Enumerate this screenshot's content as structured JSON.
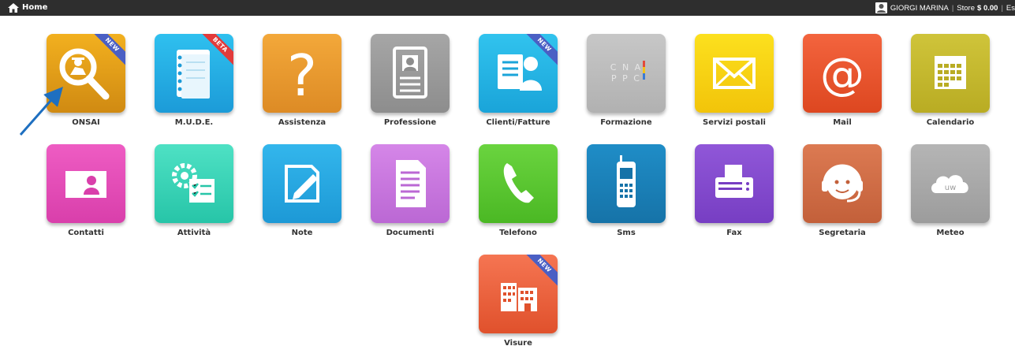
{
  "topbar": {
    "home_label": "Home",
    "user_name": "GIORGI MARINA",
    "store_label": "Store",
    "store_currency": "$",
    "store_amount": "0.00",
    "exit_label": "Es"
  },
  "tiles": [
    {
      "label": "ONSAI",
      "ribbon": "NEW",
      "color_top": "#f2b01f",
      "color_bottom": "#d08a12",
      "icon": "magnifier-worker-icon"
    },
    {
      "label": "M.U.D.E.",
      "ribbon": "BETA",
      "color_top": "#2fc0ef",
      "color_bottom": "#1c9bd8",
      "icon": "notebook-icon"
    },
    {
      "label": "Assistenza",
      "ribbon": "",
      "color_top": "#f3a83a",
      "color_bottom": "#dd8b25",
      "icon": "question-mark-icon"
    },
    {
      "label": "Professione",
      "ribbon": "",
      "color_top": "#a6a6a6",
      "color_bottom": "#8d8d8d",
      "icon": "id-card-icon"
    },
    {
      "label": "Clienti/Fatture",
      "ribbon": "NEW",
      "color_top": "#31c3ee",
      "color_bottom": "#1aa4d9",
      "icon": "invoice-client-icon"
    },
    {
      "label": "Formazione",
      "ribbon": "",
      "color_top": "#c7c7c7",
      "color_bottom": "#b1b1b1",
      "icon": "cna-ppc-logo"
    },
    {
      "label": "Servizi postali",
      "ribbon": "",
      "color_top": "#fce01e",
      "color_bottom": "#f2c40a",
      "icon": "envelope-icon"
    },
    {
      "label": "Mail",
      "ribbon": "",
      "color_top": "#f3643e",
      "color_bottom": "#dd4720",
      "icon": "at-sign-icon"
    },
    {
      "label": "Calendario",
      "ribbon": "",
      "color_top": "#cfc43a",
      "color_bottom": "#b9ac23",
      "icon": "calendar-icon"
    },
    {
      "label": "Contatti",
      "ribbon": "",
      "color_top": "#ee5cc3",
      "color_bottom": "#d93fab",
      "icon": "contact-card-icon"
    },
    {
      "label": "Attività",
      "ribbon": "",
      "color_top": "#4ee1c4",
      "color_bottom": "#27c5a8",
      "icon": "gear-checklist-icon"
    },
    {
      "label": "Note",
      "ribbon": "",
      "color_top": "#33b6ec",
      "color_bottom": "#1d99d6",
      "icon": "note-pencil-icon"
    },
    {
      "label": "Documenti",
      "ribbon": "",
      "color_top": "#d586e8",
      "color_bottom": "#bb68d4",
      "icon": "document-icon"
    },
    {
      "label": "Telefono",
      "ribbon": "",
      "color_top": "#6ad43f",
      "color_bottom": "#4bb824",
      "icon": "phone-handset-icon"
    },
    {
      "label": "Sms",
      "ribbon": "",
      "color_top": "#1f8dc7",
      "color_bottom": "#1673a8",
      "icon": "mobile-phone-icon"
    },
    {
      "label": "Fax",
      "ribbon": "",
      "color_top": "#9057d8",
      "color_bottom": "#773ec3",
      "icon": "fax-icon"
    },
    {
      "label": "Segretaria",
      "ribbon": "",
      "color_top": "#dc7a52",
      "color_bottom": "#c3603a",
      "icon": "headset-operator-icon"
    },
    {
      "label": "Meteo",
      "ribbon": "",
      "color_top": "#b5b5b5",
      "color_bottom": "#9c9c9c",
      "icon": "cloud-icon"
    },
    {
      "label": "Visure",
      "ribbon": "NEW",
      "color_top": "#f57552",
      "color_bottom": "#e0512c",
      "icon": "buildings-icon"
    }
  ],
  "formazione_logo": {
    "line1": "C N A",
    "line2": "P P C"
  },
  "calendar_badge": "",
  "meteo_badge": "UW"
}
